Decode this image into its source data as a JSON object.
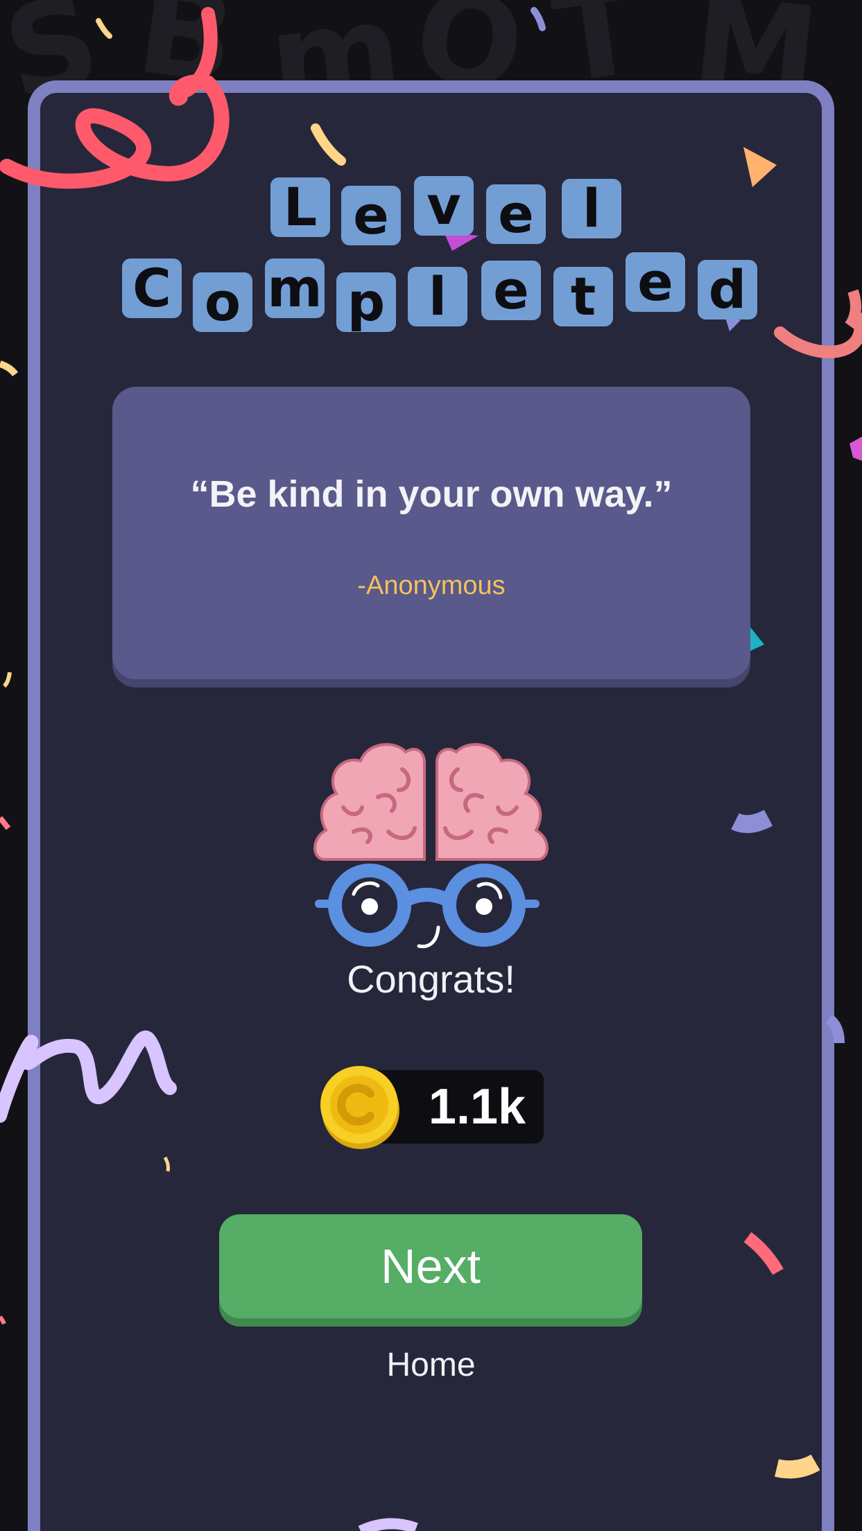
{
  "title": {
    "line1": [
      "L",
      "e",
      "v",
      "e",
      "l"
    ],
    "line2": [
      "C",
      "o",
      "m",
      "p",
      "l",
      "e",
      "t",
      "e",
      "d"
    ]
  },
  "quote": {
    "text": "“Be kind in your own way.”",
    "author": "-Anonymous"
  },
  "mascot": {
    "icon": "brain-with-glasses-icon"
  },
  "congrats_label": "Congrats!",
  "coins": {
    "icon": "gold-coin-icon",
    "value": "1.1k"
  },
  "buttons": {
    "next_label": "Next",
    "home_label": "Home"
  },
  "colors": {
    "background": "#121216",
    "panel": "#26273b",
    "panel_border": "#7f80c1",
    "tile": "#729ed4",
    "quote_card": "#59598b",
    "quote_author": "#f5c25a",
    "next_button": "#55ad66"
  }
}
